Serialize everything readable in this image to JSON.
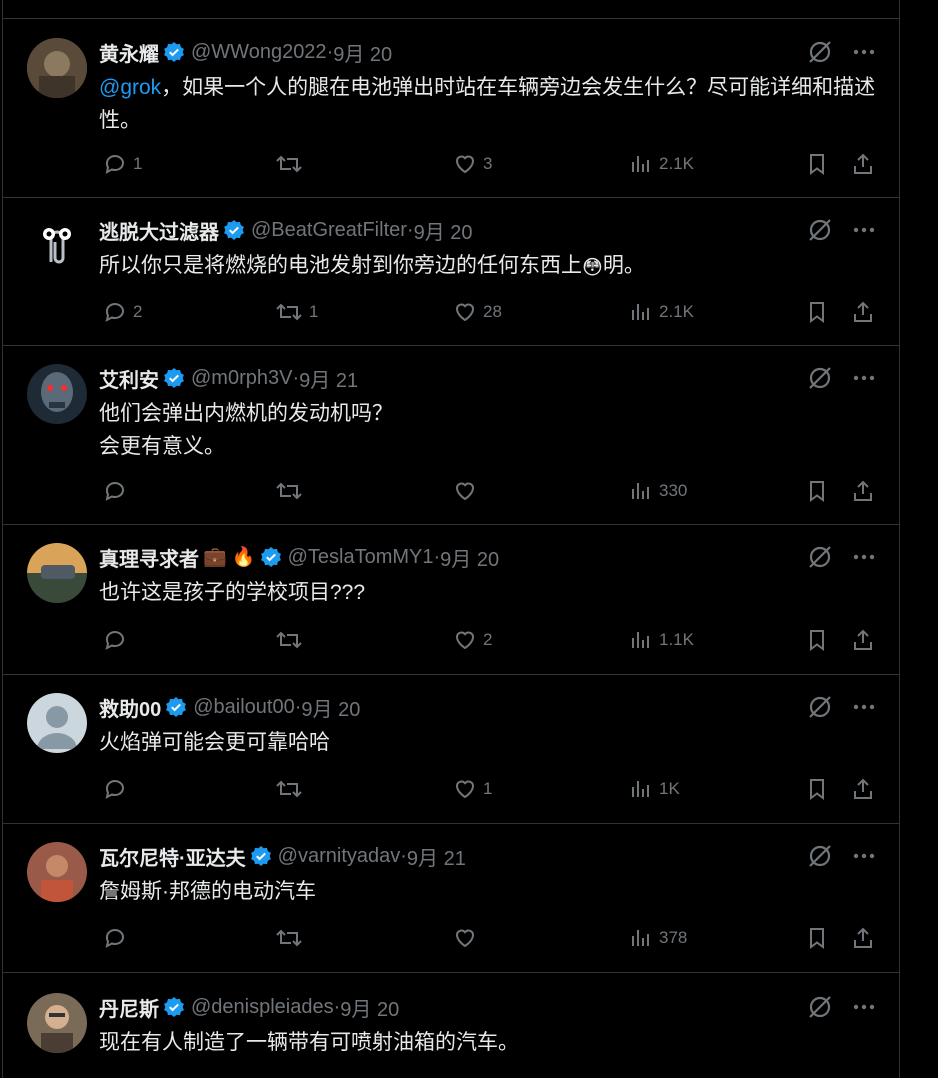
{
  "tweets": [
    {
      "name": "黄永耀",
      "badge_emoji": "",
      "handle": "@WWong2022",
      "sep": " · ",
      "date": "9月 20",
      "mention": "@grok",
      "text": "，如果一个人的腿在电池弹出时站在车辆旁边会发生什么？尽可能详细和描述性。",
      "reply": "1",
      "retweet": "",
      "like": "3",
      "views": "2.1K",
      "avatar_color": "#6b5e4e"
    },
    {
      "name": "逃脱大过滤器",
      "badge_emoji": "",
      "handle": "@BeatGreatFilter",
      "sep": " · ",
      "date": "9月 20",
      "mention": "",
      "text": "所以你只是将燃烧的电池发射到你旁边的任何东西上",
      "emoji_inline": "😳",
      "text_after": "明。",
      "reply": "2",
      "retweet": "1",
      "like": "28",
      "views": "2.1K",
      "avatar_color": "#000000"
    },
    {
      "name": "艾利安",
      "badge_emoji": "",
      "handle": "@m0rph3V",
      "sep": " · ",
      "date": "9月 21",
      "mention": "",
      "text": "他们会弹出内燃机的发动机吗？\n会更有意义。",
      "reply": "",
      "retweet": "",
      "like": "",
      "views": "330",
      "avatar_color": "#3a4a5a"
    },
    {
      "name": "真理寻求者",
      "badge_emoji": "💼 🔥",
      "handle": "@TeslaTomMY1",
      "sep": " · ",
      "date": "9月 20",
      "mention": "",
      "text": "也许这是孩子的学校项目???",
      "reply": "",
      "retweet": "",
      "like": "2",
      "views": "1.1K",
      "avatar_color": "#a08a55"
    },
    {
      "name": "救助00",
      "badge_emoji": "",
      "handle": "@bailout00",
      "sep": " · ",
      "date": "9月 20",
      "mention": "",
      "text": "火焰弹可能会更可靠哈哈",
      "reply": "",
      "retweet": "",
      "like": "1",
      "views": "1K",
      "avatar_color": "#ccd6dd"
    },
    {
      "name": "瓦尔尼特·亚达夫",
      "badge_emoji": "",
      "handle": "@varnityadav",
      "sep": " · ",
      "date": "9月 21",
      "mention": "",
      "text": "詹姆斯·邦德的电动汽车",
      "reply": "",
      "retweet": "",
      "like": "",
      "views": "378",
      "avatar_color": "#8a4a3a"
    },
    {
      "name": "丹尼斯",
      "badge_emoji": "",
      "handle": "@denispleiades",
      "sep": " · ",
      "date": "9月 20",
      "mention": "",
      "text": "现在有人制造了一辆带有可喷射油箱的汽车。",
      "reply": "",
      "retweet": "",
      "like": "",
      "views": "",
      "avatar_color": "#6a5a4a"
    }
  ],
  "colors": {
    "accent": "#1d9bf0",
    "muted": "#71767b",
    "text": "#e7e9ea",
    "border": "#2f3336"
  },
  "icons": [
    "grok-icon",
    "more-icon",
    "reply-icon",
    "retweet-icon",
    "like-icon",
    "views-icon",
    "bookmark-icon",
    "share-icon",
    "verified-icon"
  ]
}
